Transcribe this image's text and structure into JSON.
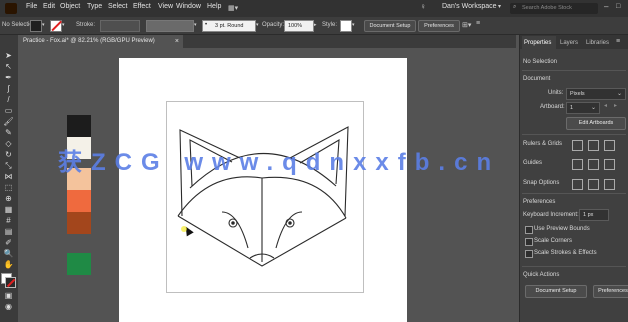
{
  "menu": [
    "File",
    "Edit",
    "Object",
    "Type",
    "Select",
    "Effect",
    "View",
    "Window",
    "Help"
  ],
  "workspace": "Dan's Workspace",
  "search_placeholder": "Search Adobe Stock",
  "control": {
    "left_label": "No Selection",
    "stroke_label": "Stroke:",
    "brush": "3 pt. Round",
    "opacity_label": "Opacity:",
    "opacity_value": "100%",
    "style_label": "Style:",
    "doc_setup": "Document Setup",
    "prefs": "Preferences"
  },
  "document_tab": "Practice - Fox.ai* @ 82.21% (RGB/GPU Preview)",
  "properties": {
    "tabs": [
      "Properties",
      "Layers",
      "Libraries"
    ],
    "no_selection": "No Selection",
    "document": "Document",
    "units_label": "Units:",
    "units_value": "Pixels",
    "artboard_label": "Artboard:",
    "artboard_value": "1",
    "edit_artboards": "Edit Artboards",
    "rulers": "Rulers & Grids",
    "guides": "Guides",
    "snap": "Snap Options",
    "preferences": "Preferences",
    "keyboard_label": "Keyboard Increment:",
    "keyboard_value": "1 px",
    "checks": [
      "Use Preview Bounds",
      "Scale Corners",
      "Scale Strokes & Effects"
    ],
    "quick_actions": "Quick Actions",
    "qa_doc_setup": "Document Setup",
    "qa_prefs": "Preferences"
  },
  "watermark": "获ZCG www.qdnxxfb.cn",
  "swatches": [
    "#1c1c1c",
    "#f4f1e8",
    "#f4c39c",
    "#ef6a3e",
    "#a3461c",
    "#1f8a45"
  ],
  "colors": {
    "accent": "#5b7fe6",
    "panel": "#404040",
    "canvas": "#535353"
  }
}
